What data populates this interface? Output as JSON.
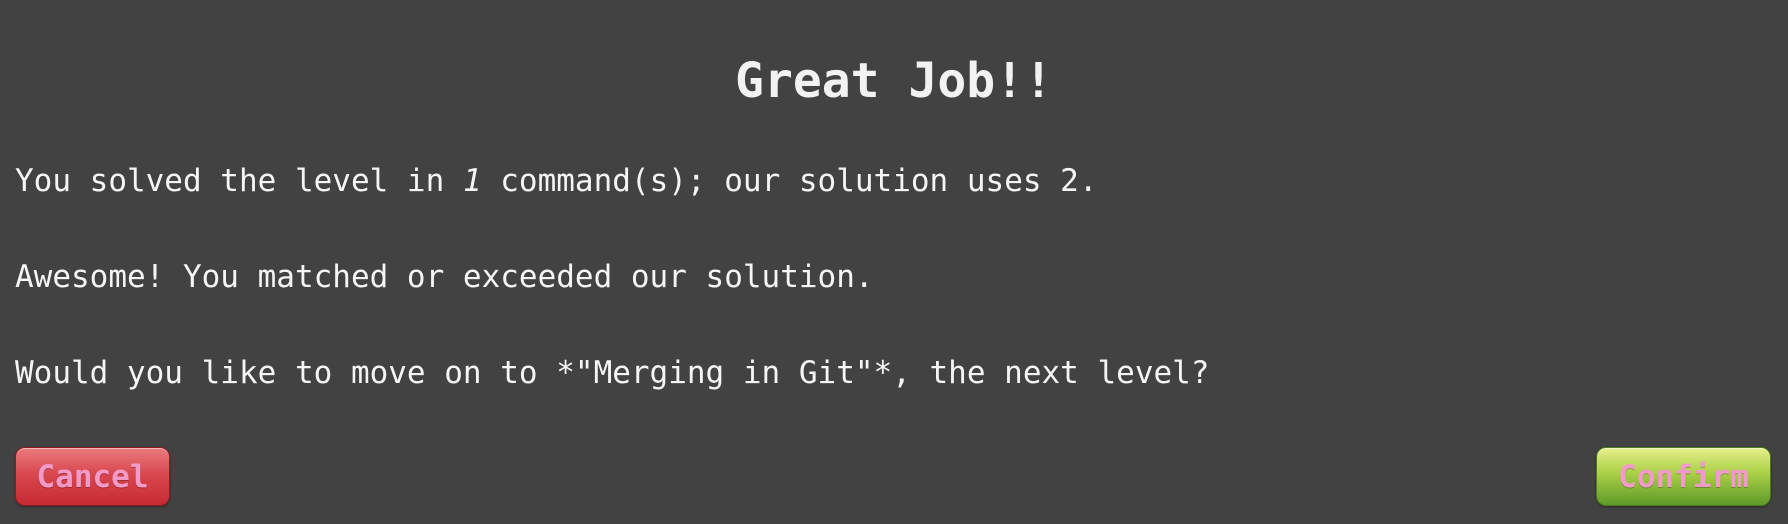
{
  "dialog": {
    "title": "Great Job!!",
    "line1": {
      "before": "You solved the level in ",
      "user_commands": "1",
      "after": " command(s); our solution uses 2."
    },
    "line2": "Awesome! You matched or exceeded our solution.",
    "line3": "Would you like to move on to *\"Merging in Git\"*, the next level?"
  },
  "buttons": {
    "cancel_label": "Cancel",
    "confirm_label": "Confirm"
  },
  "colors": {
    "background": "#424242",
    "button_text": "#f29ac8",
    "cancel": "#d9484f",
    "confirm": "#a9cf46"
  }
}
